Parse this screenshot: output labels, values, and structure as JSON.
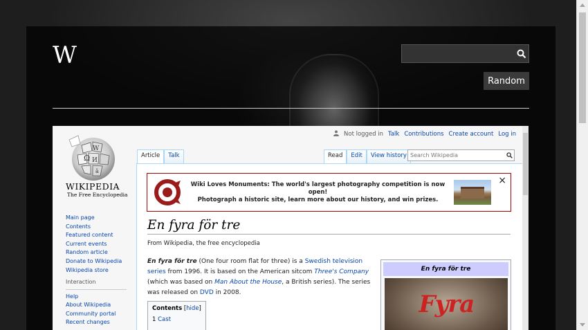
{
  "header": {
    "logo_letter": "W",
    "search_placeholder": "",
    "random_label": "Random"
  },
  "wiki": {
    "usernav": {
      "status": "Not logged in",
      "talk": "Talk",
      "contributions": "Contributions",
      "create_account": "Create account",
      "login": "Log in"
    },
    "logo_wordmark": "Wikipedia",
    "logo_tagline": "The Free Encyclopedia",
    "sidebar": {
      "items": [
        "Main page",
        "Contents",
        "Featured content",
        "Current events",
        "Random article",
        "Donate to Wikipedia",
        "Wikipedia store"
      ],
      "interaction_heading": "Interaction",
      "interaction_items": [
        "Help",
        "About Wikipedia",
        "Community portal",
        "Recent changes"
      ]
    },
    "tabs": {
      "article": "Article",
      "talk": "Talk",
      "read": "Read",
      "edit": "Edit",
      "history": "View history"
    },
    "search_placeholder": "Search Wikipedia",
    "banner": {
      "line1": "Wiki Loves Monuments: The world's largest photography competition is now open!",
      "line2": "Photograph a historic site, learn more about our history, and win prizes.",
      "close": "×"
    },
    "article": {
      "title": "En fyra för tre",
      "from": "From Wikipedia, the free encyclopedia",
      "p_bold": "En fyra för tre",
      "p1": " (One four room flat for three) is a ",
      "link1": "Swedish television series",
      "p2": " from 1996. It is based on the American sitcom ",
      "link2": "Three's Company",
      "p3": " (which was based on ",
      "link3": "Man About the House",
      "p4": ", a British series). The series was released on ",
      "link4": "DVD",
      "p5": " in 2008."
    },
    "toc": {
      "title": "Contents",
      "hide": "hide",
      "items": [
        {
          "num": "1",
          "label": "Cast"
        }
      ]
    },
    "infobox": {
      "title": "En fyra för tre",
      "image_text": "Fyra"
    }
  }
}
